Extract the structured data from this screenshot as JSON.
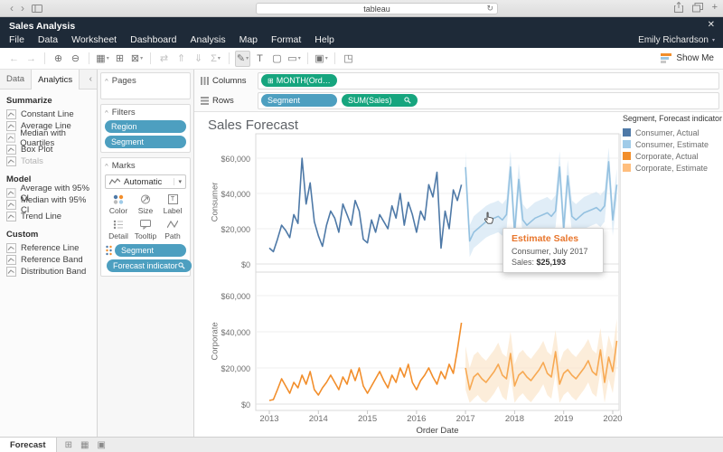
{
  "browser": {
    "url": "tableau"
  },
  "glyphs": {
    "nav_back": "‹",
    "nav_forward": "›",
    "refresh": "↻",
    "plus": "+",
    "close": "✕",
    "user_caret": "▾",
    "collapse_caret": "^",
    "panel_collapse": "‹",
    "dropdown_caret": "▾"
  },
  "app_bar": {
    "title": "Sales Analysis",
    "menus": [
      "File",
      "Data",
      "Worksheet",
      "Dashboard",
      "Analysis",
      "Map",
      "Format",
      "Help"
    ],
    "user": "Emily Richardson"
  },
  "toolbar": {
    "show_me_label": "Show Me",
    "icons": [
      {
        "name": "undo-icon",
        "glyph": "←",
        "disabled": true
      },
      {
        "name": "redo-icon",
        "glyph": "→",
        "disabled": true
      },
      {
        "sep": true
      },
      {
        "name": "add-datasource-icon",
        "glyph": "⊕"
      },
      {
        "name": "pause-updates-icon",
        "glyph": "⊖"
      },
      {
        "sep": true
      },
      {
        "name": "new-worksheet-icon",
        "glyph": "▦",
        "caret": true
      },
      {
        "name": "duplicate-sheet-icon",
        "glyph": "⊞"
      },
      {
        "name": "clear-sheet-icon",
        "glyph": "⊠",
        "caret": true
      },
      {
        "sep": true
      },
      {
        "name": "swap-axes-icon",
        "glyph": "⇄",
        "disabled": true
      },
      {
        "name": "sort-ascending-icon",
        "glyph": "⇑",
        "disabled": true
      },
      {
        "name": "sort-descending-icon",
        "glyph": "⇓",
        "disabled": true
      },
      {
        "name": "totals-icon",
        "glyph": "Σ",
        "caret": true,
        "disabled": true
      },
      {
        "sep": true
      },
      {
        "name": "highlight-icon",
        "glyph": "✎",
        "caret": true,
        "active": true
      },
      {
        "name": "mark-labels-icon",
        "glyph": "T"
      },
      {
        "name": "fit-edit-icon",
        "glyph": "▢"
      },
      {
        "name": "cell-size-icon",
        "glyph": "▭",
        "caret": true
      },
      {
        "sep": true
      },
      {
        "name": "view-labels-icon",
        "glyph": "▣",
        "caret": true
      },
      {
        "sep": true
      },
      {
        "name": "tooltip-mode-icon",
        "glyph": "◳"
      }
    ]
  },
  "left_panel": {
    "tabs": {
      "data": "Data",
      "analytics": "Analytics"
    },
    "sections": [
      {
        "title": "Summarize",
        "items": [
          "Constant Line",
          "Average Line",
          "Median with Quartiles",
          "Box Plot",
          "Totals"
        ],
        "disabled": [
          "Totals"
        ]
      },
      {
        "title": "Model",
        "items": [
          "Average with 95% CI",
          "Median with 95% CI",
          "Trend Line"
        ],
        "disabled": []
      },
      {
        "title": "Custom",
        "items": [
          "Reference Line",
          "Reference Band",
          "Distribution Band"
        ],
        "disabled": []
      }
    ]
  },
  "cards": {
    "pages": {
      "title": "Pages"
    },
    "filters": {
      "title": "Filters",
      "pills": [
        "Region",
        "Segment"
      ]
    },
    "marks": {
      "title": "Marks",
      "mark_type": "Automatic",
      "buttons": [
        "Color",
        "Size",
        "Label",
        "Detail",
        "Tooltip",
        "Path"
      ],
      "pills": [
        {
          "label": "Segment",
          "pin": false
        },
        {
          "label": "Forecast indicator",
          "pin": true
        }
      ]
    }
  },
  "shelves": {
    "columns_label": "Columns",
    "rows_label": "Rows",
    "pills": {
      "columns": "MONTH(Order Date)",
      "segment": "Segment",
      "sum_sales": "SUM(Sales)"
    }
  },
  "sheet": {
    "title": "Sales Forecast"
  },
  "legend": {
    "title": "Segment, Forecast indicator",
    "items": [
      {
        "label": "Consumer, Actual",
        "color": "#4e79a7"
      },
      {
        "label": "Consumer, Estimate",
        "color": "#a0cbe8"
      },
      {
        "label": "Corporate, Actual",
        "color": "#f28e2b"
      },
      {
        "label": "Corporate, Estimate",
        "color": "#ffbe7d"
      }
    ]
  },
  "tooltip": {
    "title": "Estimate Sales",
    "line2": "Consumer, July 2017",
    "label": "Sales:",
    "value": "$25,193"
  },
  "status_bar": {
    "active_tab": "Forecast",
    "icons": [
      {
        "name": "new-worksheet-icon",
        "glyph": "⊞"
      },
      {
        "name": "new-dashboard-icon",
        "glyph": "▦"
      },
      {
        "name": "new-story-icon",
        "glyph": "▣"
      }
    ]
  },
  "chart_data": {
    "type": "line",
    "title": "Sales Forecast",
    "xlabel": "Order Date",
    "x_ticks": [
      "2013",
      "2014",
      "2015",
      "2016",
      "2017",
      "2018",
      "2019",
      "2020"
    ],
    "y_ticks": [
      "$0",
      "$20,000",
      "$40,000",
      "$60,000"
    ],
    "ylim": [
      0,
      70000
    ],
    "legend_position": "top-right",
    "grid": true,
    "panels": [
      {
        "row_label": "Consumer",
        "series": [
          {
            "name": "Consumer, Actual",
            "color": "#4e79a7",
            "start_month": 0,
            "values": [
              9000,
              7000,
              14000,
              22000,
              19000,
              15000,
              28000,
              23000,
              60000,
              34000,
              46000,
              24000,
              16000,
              10000,
              22000,
              30000,
              26000,
              18000,
              34000,
              28000,
              22000,
              36000,
              30000,
              14000,
              12000,
              25000,
              18000,
              28000,
              24000,
              20000,
              33000,
              26000,
              40000,
              22000,
              35000,
              28000,
              18000,
              30000,
              25000,
              45000,
              38000,
              52000,
              9000,
              30000,
              20000,
              42000,
              36000,
              45000
            ]
          },
          {
            "name": "Consumer, Estimate",
            "color": "#94c1e0",
            "band_color": "#cfe3f2",
            "band_delta": 9000,
            "start_month": 48,
            "values": [
              55000,
              13000,
              18000,
              20000,
              22000,
              24000,
              25193,
              26000,
              27000,
              25000,
              28000,
              55000,
              18000,
              48000,
              25000,
              22000,
              24000,
              26000,
              27000,
              28000,
              29000,
              27000,
              30000,
              55000,
              20000,
              50000,
              27000,
              25000,
              27000,
              29000,
              30000,
              31000,
              32000,
              30000,
              33000,
              58000,
              25000,
              45000
            ]
          }
        ]
      },
      {
        "row_label": "Corporate",
        "series": [
          {
            "name": "Corporate, Actual",
            "color": "#f28e2b",
            "start_month": 0,
            "values": [
              2000,
              2500,
              8000,
              14000,
              10000,
              6000,
              12000,
              9000,
              16000,
              11000,
              18000,
              8000,
              5000,
              9000,
              12000,
              16000,
              12000,
              8000,
              15000,
              11000,
              19000,
              13000,
              20000,
              10000,
              6000,
              10000,
              14000,
              18000,
              13000,
              9000,
              16000,
              12000,
              20000,
              15000,
              22000,
              12000,
              8000,
              13000,
              16000,
              20000,
              15000,
              11000,
              18000,
              14000,
              22000,
              17000,
              30000,
              45000
            ]
          },
          {
            "name": "Corporate, Estimate",
            "color": "#f7a953",
            "band_color": "#fbe3c6",
            "band_delta": 12000,
            "start_month": 48,
            "values": [
              20000,
              8000,
              15000,
              17000,
              14000,
              12000,
              15000,
              18000,
              22000,
              16000,
              14000,
              28000,
              10000,
              16000,
              18000,
              15000,
              13000,
              16000,
              19000,
              23000,
              17000,
              15000,
              29000,
              11000,
              17000,
              19000,
              16000,
              14000,
              17000,
              20000,
              24000,
              18000,
              16000,
              30000,
              12000,
              26000,
              18000,
              35000
            ]
          }
        ]
      }
    ]
  }
}
